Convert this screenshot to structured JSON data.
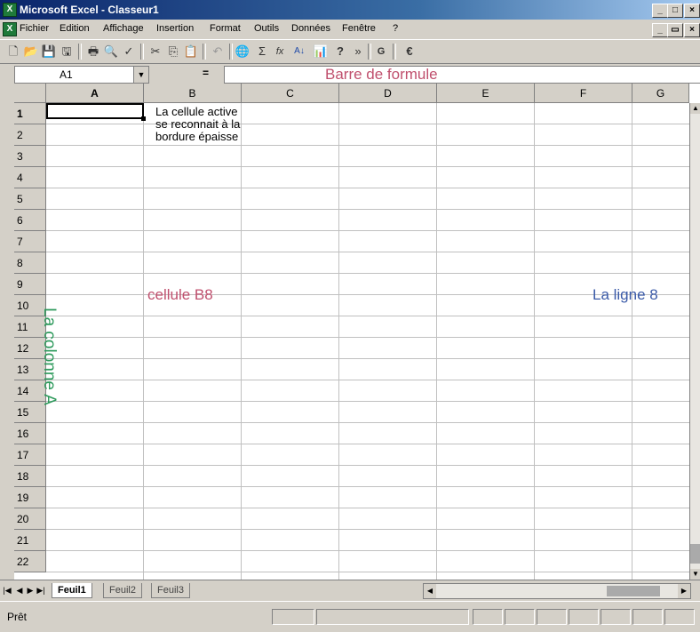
{
  "window": {
    "title": "Microsoft Excel - Classeur1",
    "app_icon": "excel-icon",
    "controls": [
      "_",
      "□",
      "×"
    ]
  },
  "menu": {
    "items": [
      "Fichier",
      "Edition",
      "Affichage",
      "Insertion",
      "Format",
      "Outils",
      "Données",
      "Fenêtre",
      "?"
    ],
    "doc_controls": [
      "_",
      "▭",
      "×"
    ]
  },
  "toolbar": {
    "buttons": [
      {
        "icon": "new-icon",
        "glyph": "🗋"
      },
      {
        "icon": "open-icon",
        "glyph": "📂"
      },
      {
        "icon": "save-icon",
        "glyph": "💾"
      },
      {
        "icon": "permission-icon",
        "glyph": "🖫"
      },
      {
        "icon": "print-icon",
        "glyph": "🖶"
      },
      {
        "icon": "print-preview-icon",
        "glyph": "🔍"
      },
      {
        "icon": "spelling-icon",
        "glyph": "✓"
      },
      {
        "icon": "cut-icon",
        "glyph": "✂"
      },
      {
        "icon": "copy-icon",
        "glyph": "⎘"
      },
      {
        "icon": "paste-icon",
        "glyph": "📋"
      },
      {
        "icon": "undo-icon",
        "glyph": "↶"
      },
      {
        "icon": "hyperlink-icon",
        "glyph": "🌐"
      },
      {
        "icon": "autosum-icon",
        "glyph": "Σ"
      },
      {
        "icon": "function-icon",
        "glyph": "fx"
      },
      {
        "icon": "sort-ascending-icon",
        "glyph": "A↓"
      },
      {
        "icon": "chart-wizard-icon",
        "glyph": "📊"
      },
      {
        "icon": "help-icon",
        "glyph": "?"
      },
      {
        "icon": "more-options-icon",
        "glyph": "»"
      },
      {
        "icon": "bold-icon",
        "glyph": "G"
      },
      {
        "icon": "euro-icon",
        "glyph": "€"
      }
    ]
  },
  "formula": {
    "namebox": "A1",
    "equals": "=",
    "annotation": "Barre de formule"
  },
  "grid": {
    "columns": [
      "A",
      "B",
      "C",
      "D",
      "E",
      "F",
      "G"
    ],
    "rows": [
      "1",
      "2",
      "3",
      "4",
      "5",
      "6",
      "7",
      "8",
      "9",
      "10",
      "11",
      "12",
      "13",
      "14",
      "15",
      "16",
      "17",
      "18",
      "19",
      "20",
      "21",
      "22"
    ],
    "active_cell": "A1",
    "cell_note": [
      "La cellule active",
      "se reconnait à la",
      "bordure épaisse"
    ],
    "label_column": "La colonne A",
    "label_cell": "cellule B8",
    "label_row": "La ligne 8",
    "colors": {
      "label_column": "#2e9a5c",
      "label_cell": "#c0506e",
      "label_row": "#3a5aa8",
      "formula_annotation": "#c0506e"
    }
  },
  "sheets": {
    "tabs": [
      "Feuil1",
      "Feuil2",
      "Feuil3"
    ],
    "active": "Feuil1"
  },
  "status": {
    "text": "Prêt"
  }
}
